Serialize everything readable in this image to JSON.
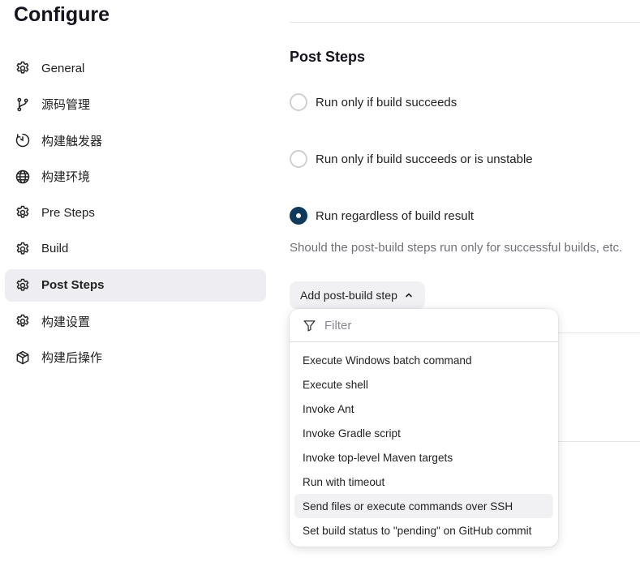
{
  "page": {
    "title": "Configure"
  },
  "sidebar": {
    "items": [
      {
        "label": "General",
        "icon": "gear-icon"
      },
      {
        "label": "源码管理",
        "icon": "branch-icon"
      },
      {
        "label": "构建触发器",
        "icon": "timer-icon"
      },
      {
        "label": "构建环境",
        "icon": "globe-icon"
      },
      {
        "label": "Pre Steps",
        "icon": "gear-icon"
      },
      {
        "label": "Build",
        "icon": "gear-icon"
      },
      {
        "label": "Post Steps",
        "icon": "gear-icon",
        "active": true
      },
      {
        "label": "构建设置",
        "icon": "gear-icon"
      },
      {
        "label": "构建后操作",
        "icon": "package-icon"
      }
    ]
  },
  "main": {
    "section_title": "Post Steps",
    "options": [
      {
        "label": "Run only if build succeeds",
        "checked": false
      },
      {
        "label": "Run only if build succeeds or is unstable",
        "checked": false
      },
      {
        "label": "Run regardless of build result",
        "checked": true
      }
    ],
    "help_text": "Should the post-build steps run only for successful builds, etc.",
    "add_button_label": "Add post-build step"
  },
  "dropdown": {
    "filter_placeholder": "Filter",
    "items": [
      "Execute Windows batch command",
      "Execute shell",
      "Invoke Ant",
      "Invoke Gradle script",
      "Invoke top-level Maven targets",
      "Run with timeout",
      "Send files or execute commands over SSH",
      "Set build status to \"pending\" on GitHub commit"
    ],
    "hovered_item": "Send files or execute commands over SSH"
  },
  "colors": {
    "accent": "#0f3a5c",
    "active_nav_bg": "#ededf2",
    "help_text": "#707078"
  }
}
